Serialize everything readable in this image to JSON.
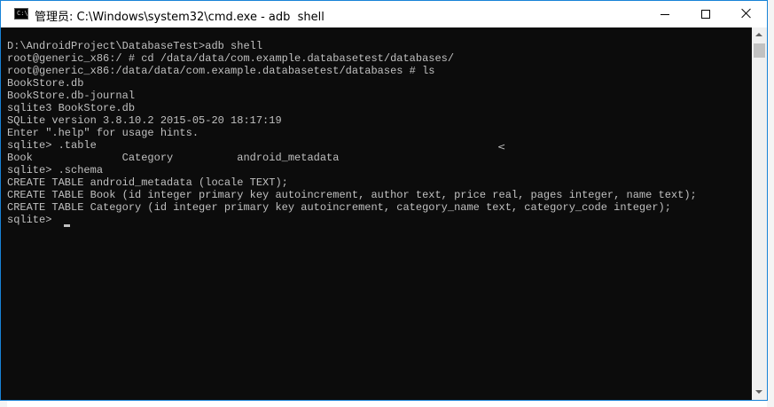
{
  "window": {
    "title": "管理员: C:\\Windows\\system32\\cmd.exe - adb  shell",
    "icon_text": "C:\\",
    "controls": [
      "minimize-icon",
      "maximize-icon",
      "close-icon"
    ]
  },
  "console": {
    "lines": [
      "D:\\AndroidProject\\DatabaseTest>adb shell",
      "root@generic_x86:/ # cd /data/data/com.example.databasetest/databases/",
      "root@generic_x86:/data/data/com.example.databasetest/databases # ls",
      "BookStore.db",
      "BookStore.db-journal",
      "sqlite3 BookStore.db",
      "SQLite version 3.8.10.2 2015-05-20 18:17:19",
      "Enter \".help\" for usage hints.",
      "sqlite> .table",
      "Book              Category          android_metadata",
      "sqlite> .schema",
      "CREATE TABLE android_metadata (locale TEXT);",
      "CREATE TABLE Book (id integer primary key autoincrement, author text, price real, pages integer, name text);",
      "CREATE TABLE Category (id integer primary key autoincrement, category_name text, category_code integer);",
      "sqlite> "
    ],
    "stray_glyph": "<"
  },
  "colors": {
    "console_bg": "#0c0c0c",
    "console_fg": "#c0c0c0",
    "titlebar_bg": "#ffffff",
    "border": "#1883d7"
  }
}
